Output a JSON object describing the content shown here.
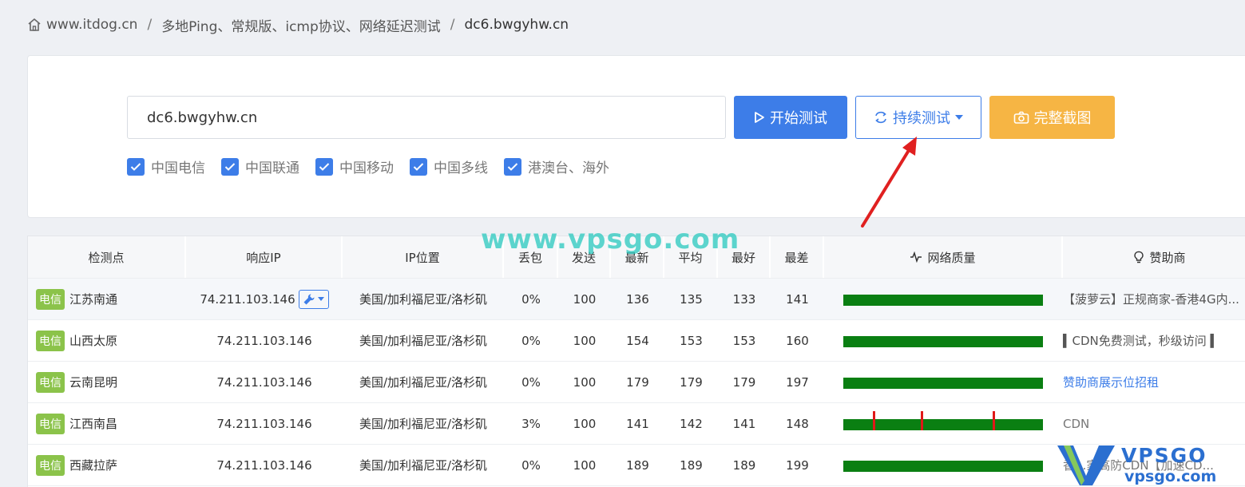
{
  "breadcrumb": {
    "home": "www.itdog.cn",
    "section": "多地Ping、常规版、icmp协议、网络延迟测试",
    "current": "dc6.bwgyhw.cn"
  },
  "search": {
    "value": "dc6.bwgyhw.cn",
    "start_label": "开始测试",
    "continuous_label": "持续测试",
    "screenshot_label": "完整截图"
  },
  "filters": [
    {
      "label": "中国电信",
      "checked": true
    },
    {
      "label": "中国联通",
      "checked": true
    },
    {
      "label": "中国移动",
      "checked": true
    },
    {
      "label": "中国多线",
      "checked": true
    },
    {
      "label": "港澳台、海外",
      "checked": true
    }
  ],
  "watermark": "www.vpsgo.com",
  "table": {
    "headers": {
      "point": "检测点",
      "ip": "响应IP",
      "location": "IP位置",
      "loss": "丢包",
      "sent": "发送",
      "last": "最新",
      "avg": "平均",
      "best": "最好",
      "worst": "最差",
      "quality": "网络质量",
      "sponsor": "赞助商"
    },
    "rows": [
      {
        "isp": "电信",
        "point": "江苏南通",
        "ip": "74.211.103.146",
        "location": "美国/加利福尼亚/洛杉矶",
        "loss": "0%",
        "sent": "100",
        "last": "136",
        "avg": "135",
        "best": "133",
        "worst": "141",
        "sponsor": "【菠萝云】正规商家-香港4G内..."
      },
      {
        "isp": "电信",
        "point": "山西太原",
        "ip": "74.211.103.146",
        "location": "美国/加利福尼亚/洛杉矶",
        "loss": "0%",
        "sent": "100",
        "last": "154",
        "avg": "153",
        "best": "153",
        "worst": "160",
        "sponsor": "▍CDN免费测试，秒级访问 ▍"
      },
      {
        "isp": "电信",
        "point": "云南昆明",
        "ip": "74.211.103.146",
        "location": "美国/加利福尼亚/洛杉矶",
        "loss": "0%",
        "sent": "100",
        "last": "179",
        "avg": "179",
        "best": "179",
        "worst": "197",
        "sponsor": "赞助商展示位招租"
      },
      {
        "isp": "电信",
        "point": "江西南昌",
        "ip": "74.211.103.146",
        "location": "美国/加利福尼亚/洛杉矶",
        "loss": "3%",
        "sent": "100",
        "last": "141",
        "avg": "142",
        "best": "141",
        "worst": "148",
        "sponsor": "CDN"
      },
      {
        "isp": "电信",
        "point": "西藏拉萨",
        "ip": "74.211.103.146",
        "location": "美国/加利福尼亚/洛杉矶",
        "loss": "0%",
        "sent": "100",
        "last": "189",
        "avg": "189",
        "best": "189",
        "worst": "199",
        "sponsor": "香...家高防CDN【加速CD..."
      }
    ]
  },
  "logo": {
    "top": "VPSGO",
    "bottom": "vpsgo.com"
  },
  "colors": {
    "primary": "#3d7de8",
    "warning": "#f6b544",
    "isp_badge": "#8bc34a",
    "quality_bar": "#0a7f12",
    "loss_tick": "#e01818",
    "arrow": "#e02020",
    "watermark": "#28c8be"
  }
}
